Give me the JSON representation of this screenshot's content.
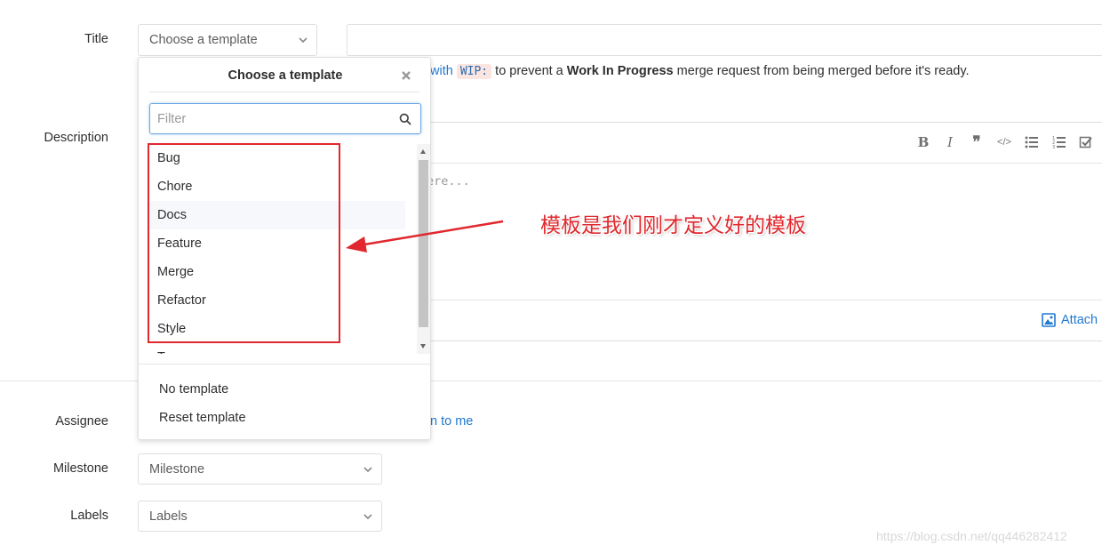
{
  "form": {
    "title_label": "Title",
    "description_label": "Description",
    "assignee_label": "Assignee",
    "milestone_label": "Milestone",
    "labels_label": "Labels",
    "template_select": "Choose a template",
    "milestone_select": "Milestone",
    "labels_select": "Labels",
    "hint_with": "with",
    "hint_code": "WIP:",
    "hint_middle": "to prevent a",
    "hint_bold": "Work In Progress",
    "hint_end": "merge request from being merged before it's ready.",
    "editor_placeholder": "ere...",
    "attach_label": "Attach",
    "assign_to_me": "n to me"
  },
  "dropdown": {
    "title": "Choose a template",
    "filter_placeholder": "Filter",
    "items": [
      {
        "label": "Bug"
      },
      {
        "label": "Chore"
      },
      {
        "label": "Docs"
      },
      {
        "label": "Feature"
      },
      {
        "label": "Merge"
      },
      {
        "label": "Refactor"
      },
      {
        "label": "Style"
      },
      {
        "label": "T"
      }
    ],
    "no_template": "No template",
    "reset_template": "Reset template"
  },
  "annotation": {
    "text": "模板是我们刚才定义好的模板",
    "color": "#e0282e"
  },
  "watermark": "https://blog.csdn.net/qq446282412",
  "colors": {
    "link": "#1f78d1",
    "border": "#dfdfdf"
  }
}
